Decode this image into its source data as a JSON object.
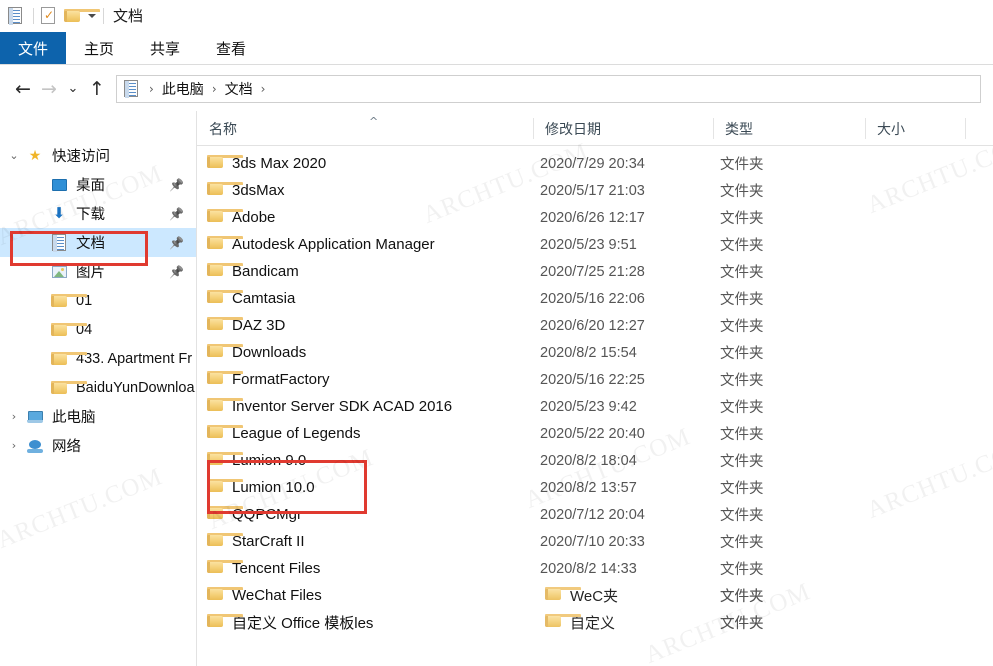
{
  "window": {
    "title": "文档",
    "quick_access_toolbar": [
      {
        "name": "properties-icon",
        "label": "属性"
      },
      {
        "name": "new-folder-icon",
        "label": "新建文件夹"
      },
      {
        "name": "customize-qat-caret",
        "label": "自定义快速访问工具栏"
      }
    ]
  },
  "ribbon": {
    "tabs": [
      {
        "label": "文件",
        "active": true
      },
      {
        "label": "主页",
        "active": false
      },
      {
        "label": "共享",
        "active": false
      },
      {
        "label": "查看",
        "active": false
      }
    ]
  },
  "nav": {
    "back": "←",
    "forward": "→",
    "recent": "⌄",
    "up": "↑",
    "breadcrumbs": [
      "此电脑",
      "文档"
    ],
    "separator": "›"
  },
  "sidebar": {
    "items": [
      {
        "label": "快速访问",
        "icon": "star-icon",
        "indent": 0,
        "chevron": "⌄",
        "pinned": false,
        "selected": false
      },
      {
        "label": "桌面",
        "icon": "desktop-icon",
        "indent": 1,
        "chevron": "",
        "pinned": true,
        "selected": false
      },
      {
        "label": "下载",
        "icon": "download-icon",
        "indent": 1,
        "chevron": "",
        "pinned": true,
        "selected": false
      },
      {
        "label": "文档",
        "icon": "documents-icon",
        "indent": 1,
        "chevron": "",
        "pinned": true,
        "selected": true
      },
      {
        "label": "图片",
        "icon": "pictures-icon",
        "indent": 1,
        "chevron": "",
        "pinned": true,
        "selected": false
      },
      {
        "label": "01",
        "icon": "folder-icon",
        "indent": 1,
        "chevron": "",
        "pinned": false,
        "selected": false
      },
      {
        "label": "04",
        "icon": "folder-icon",
        "indent": 1,
        "chevron": "",
        "pinned": false,
        "selected": false
      },
      {
        "label": "433. Apartment Fr",
        "icon": "folder-icon",
        "indent": 1,
        "chevron": "",
        "pinned": false,
        "selected": false
      },
      {
        "label": "BaiduYunDownloa",
        "icon": "folder-icon",
        "indent": 1,
        "chevron": "",
        "pinned": false,
        "selected": false
      },
      {
        "label": "此电脑",
        "icon": "this-pc-icon",
        "indent": 0,
        "chevron": "›",
        "pinned": false,
        "selected": false
      },
      {
        "label": "网络",
        "icon": "network-icon",
        "indent": 0,
        "chevron": "›",
        "pinned": false,
        "selected": false
      }
    ]
  },
  "columns": {
    "name": "名称",
    "date": "修改日期",
    "type": "类型",
    "size": "大小",
    "sort_indicator": "^"
  },
  "files": [
    {
      "name": "3ds Max 2020",
      "date": "2020/7/29 20:34",
      "type": "文件夹",
      "size": ""
    },
    {
      "name": "3dsMax",
      "date": "2020/5/17 21:03",
      "type": "文件夹",
      "size": ""
    },
    {
      "name": "Adobe",
      "date": "2020/6/26 12:17",
      "type": "文件夹",
      "size": ""
    },
    {
      "name": "Autodesk Application Manager",
      "date": "2020/5/23 9:51",
      "type": "文件夹",
      "size": ""
    },
    {
      "name": "Bandicam",
      "date": "2020/7/25 21:28",
      "type": "文件夹",
      "size": ""
    },
    {
      "name": "Camtasia",
      "date": "2020/5/16 22:06",
      "type": "文件夹",
      "size": ""
    },
    {
      "name": "DAZ 3D",
      "date": "2020/6/20 12:27",
      "type": "文件夹",
      "size": ""
    },
    {
      "name": "Downloads",
      "date": "2020/8/2 15:54",
      "type": "文件夹",
      "size": ""
    },
    {
      "name": "FormatFactory",
      "date": "2020/5/16 22:25",
      "type": "文件夹",
      "size": ""
    },
    {
      "name": "Inventor Server SDK ACAD 2016",
      "date": "2020/5/23 9:42",
      "type": "文件夹",
      "size": ""
    },
    {
      "name": "League of Legends",
      "date": "2020/5/22 20:40",
      "type": "文件夹",
      "size": ""
    },
    {
      "name": "Lumion 9.0",
      "date": "2020/8/2 18:04",
      "type": "文件夹",
      "size": ""
    },
    {
      "name": "Lumion 10.0",
      "date": "2020/8/2 13:57",
      "type": "文件夹",
      "size": ""
    },
    {
      "name": "QQPCMgr",
      "date": "2020/7/12 20:04",
      "type": "文件夹",
      "size": ""
    },
    {
      "name": "StarCraft II",
      "date": "2020/7/10 20:33",
      "type": "文件夹",
      "size": ""
    },
    {
      "name": "Tencent Files",
      "date": "2020/8/2 14:33",
      "type": "文件夹",
      "size": ""
    },
    {
      "name": "WeChat Files",
      "date": "",
      "type": "文件夹",
      "size": ""
    },
    {
      "name": "自定义 Office 模板les",
      "date": "",
      "type": "文件夹",
      "size": ""
    }
  ],
  "artifact_rows": [
    {
      "name": "WeC夹",
      "type": "文件夹"
    },
    {
      "name": "自定义",
      "type": "文件夹"
    }
  ],
  "annotations": {
    "accent_red": "#e03a30",
    "boxes": [
      {
        "name": "documents-sidebar-highlight"
      },
      {
        "name": "lumion-folders-highlight"
      }
    ]
  },
  "watermark": {
    "text": "ARCHTU.COM"
  },
  "colors": {
    "ribbon_active": "#0d63ac",
    "selection": "#cce8ff",
    "folder": "#f4cf76"
  }
}
